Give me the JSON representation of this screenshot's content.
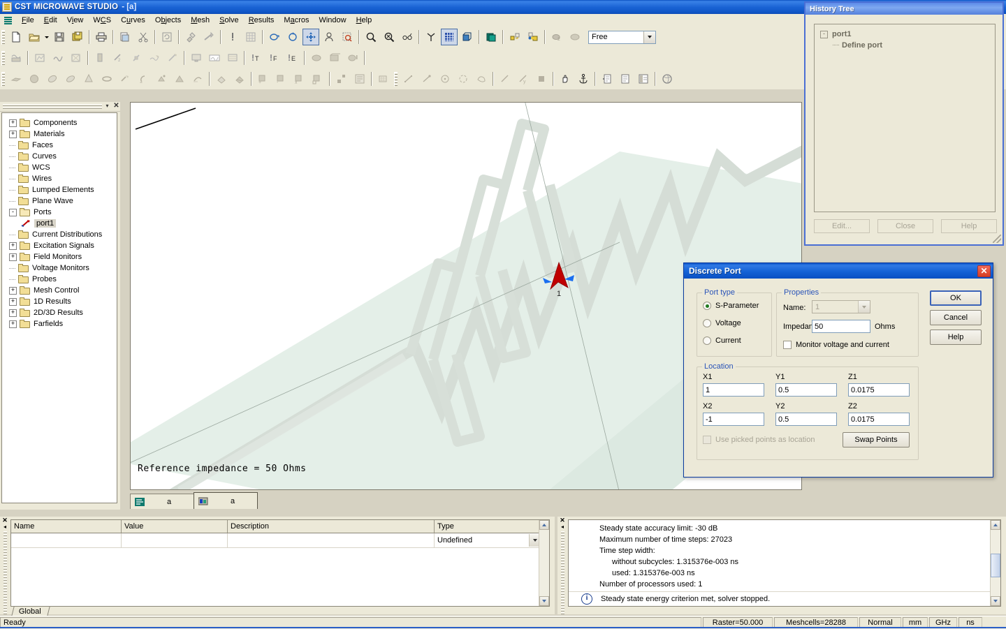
{
  "app": {
    "title": "CST MICROWAVE STUDIO",
    "document": "- [a]",
    "icon": "cst-logo-icon"
  },
  "menubar": {
    "logo_icon": "cst-menu-logo-icon",
    "items": [
      {
        "label": "File",
        "name": "menu-file"
      },
      {
        "label": "Edit",
        "name": "menu-edit"
      },
      {
        "label": "View",
        "name": "menu-view"
      },
      {
        "label": "WCS",
        "name": "menu-wcs"
      },
      {
        "label": "Curves",
        "name": "menu-curves"
      },
      {
        "label": "Objects",
        "name": "menu-objects"
      },
      {
        "label": "Mesh",
        "name": "menu-mesh"
      },
      {
        "label": "Solve",
        "name": "menu-solve"
      },
      {
        "label": "Results",
        "name": "menu-results"
      },
      {
        "label": "Macros",
        "name": "menu-macros"
      },
      {
        "label": "Window",
        "name": "menu-window"
      },
      {
        "label": "Help",
        "name": "menu-help"
      }
    ]
  },
  "toolbar": {
    "mode_combo_value": "Free",
    "row1_icons": [
      "new-file-icon",
      "open-folder-icon",
      "save-disk-icon",
      "save-all-icon",
      "print-icon",
      "print-preview-icon",
      "cut-scissors-icon",
      "refresh-icon",
      "paste-pin-icon",
      "undo-arrow-icon",
      "exclamation-icon",
      "mesh-view-icon",
      "rotate-view-icon",
      "rotate-cw-icon",
      "pan-move-icon",
      "perspective-icon",
      "zoom-region-icon",
      "zoom-in-icon",
      "zoom-out-icon",
      "view-glasses-icon",
      "axes-icon",
      "grid-icon",
      "boundary-box-icon",
      "field-plot-icon",
      "local-wcs-icon",
      "global-wcs-icon",
      "cut-plane-icon",
      "transparency-icon"
    ],
    "row2_icons": [
      "signal-icon",
      "field-monitor-icon",
      "curve-plot-icon",
      "port-box-icon",
      "waveguide-port-icon",
      "discrete-port-icon",
      "lumped-element-icon",
      "plane-wave-icon",
      "farfield-source-icon",
      "monitor-screen-icon",
      "result-template-icon",
      "post-process-icon",
      "time-monitor-icon",
      "frequency-monitor-icon",
      "energy-monitor-icon",
      "material-icon",
      "material-lib-icon",
      "material-info-icon"
    ],
    "row3_icons": [
      "brick-icon",
      "sphere-icon",
      "cylinder-icon",
      "ecylinder-icon",
      "cone-icon",
      "torus-icon",
      "extrude-icon",
      "rotate-solid-icon",
      "loft-icon",
      "sweep-icon",
      "bend-icon",
      "align-icon",
      "pick-face-icon",
      "pick-edge-icon",
      "boolean-add-icon",
      "boolean-subtract-icon",
      "boolean-intersect-icon",
      "boolean-insert-icon",
      "transform-icon",
      "properties-icon",
      "mesh-group-icon",
      "line-pick-icon",
      "point-pick-icon",
      "circle-center-icon",
      "circle-icon",
      "face-pick-icon",
      "distance-icon",
      "angle-icon",
      "area-icon",
      "pan-hand-icon",
      "anchor-icon",
      "list-add-icon",
      "list-icon",
      "list-view-icon",
      "globe-icon"
    ]
  },
  "navtree": {
    "header_buttons": [
      "minimize-icon",
      "close-icon"
    ],
    "items": [
      {
        "label": "Components",
        "expander": "+",
        "indent": 0,
        "icon": "folder-icon"
      },
      {
        "label": "Materials",
        "expander": "+",
        "indent": 0,
        "icon": "folder-icon"
      },
      {
        "label": "Faces",
        "expander": "",
        "indent": 0,
        "icon": "folder-icon"
      },
      {
        "label": "Curves",
        "expander": "",
        "indent": 0,
        "icon": "folder-icon"
      },
      {
        "label": "WCS",
        "expander": "",
        "indent": 0,
        "icon": "folder-icon"
      },
      {
        "label": "Wires",
        "expander": "",
        "indent": 0,
        "icon": "folder-icon"
      },
      {
        "label": "Lumped Elements",
        "expander": "",
        "indent": 0,
        "icon": "folder-icon"
      },
      {
        "label": "Plane Wave",
        "expander": "",
        "indent": 0,
        "icon": "folder-icon"
      },
      {
        "label": "Ports",
        "expander": "-",
        "indent": 0,
        "icon": "folder-open-icon"
      },
      {
        "label": "port1",
        "expander": "",
        "indent": 1,
        "icon": "discrete-port-icon",
        "selected": true
      },
      {
        "label": "Current Distributions",
        "expander": "",
        "indent": 0,
        "icon": "folder-icon"
      },
      {
        "label": "Excitation Signals",
        "expander": "+",
        "indent": 0,
        "icon": "folder-icon"
      },
      {
        "label": "Field Monitors",
        "expander": "+",
        "indent": 0,
        "icon": "folder-icon"
      },
      {
        "label": "Voltage Monitors",
        "expander": "",
        "indent": 0,
        "icon": "folder-icon"
      },
      {
        "label": "Probes",
        "expander": "",
        "indent": 0,
        "icon": "folder-icon"
      },
      {
        "label": "Mesh Control",
        "expander": "+",
        "indent": 0,
        "icon": "folder-icon"
      },
      {
        "label": "1D Results",
        "expander": "+",
        "indent": 0,
        "icon": "folder-icon"
      },
      {
        "label": "2D/3D Results",
        "expander": "+",
        "indent": 0,
        "icon": "folder-icon"
      },
      {
        "label": "Farfields",
        "expander": "+",
        "indent": 0,
        "icon": "folder-icon"
      }
    ]
  },
  "viewport": {
    "reference_impedance_text": "Reference impedance = 50 Ohms",
    "port_label": "1",
    "substrate_color": "#e4efe8",
    "trace_color": "#d5ddd6",
    "port_arrow_color": "#c00000",
    "port_wing_color": "#1a6ef0",
    "tabs": [
      {
        "label": "a",
        "icon": "schematic-view-icon",
        "active": false
      },
      {
        "label": "a",
        "icon": "3d-model-view-icon",
        "active": true
      }
    ]
  },
  "history_tree": {
    "title": "History Tree",
    "items": [
      {
        "label": "port1",
        "expander": "-",
        "indent": 0
      },
      {
        "label": "Define port",
        "expander": "",
        "indent": 1
      }
    ],
    "buttons": [
      {
        "label": "Edit...",
        "name": "history-edit-button"
      },
      {
        "label": "Close",
        "name": "history-close-button"
      },
      {
        "label": "Help",
        "name": "history-help-button"
      }
    ]
  },
  "dialog": {
    "title": "Discrete Port",
    "close_icon": "close-x-icon",
    "port_type": {
      "legend": "Port type",
      "options": [
        {
          "label": "S-Parameter",
          "selected": true
        },
        {
          "label": "Voltage",
          "selected": false
        },
        {
          "label": "Current",
          "selected": false
        }
      ]
    },
    "properties": {
      "legend": "Properties",
      "name_label": "Name:",
      "name_value": "1",
      "impedance_label": "Impedance:",
      "impedance_value": "50",
      "impedance_units": "Ohms",
      "monitor_label": "Monitor voltage and current",
      "monitor_checked": false
    },
    "location": {
      "legend": "Location",
      "fields": [
        {
          "label": "X1",
          "value": "1"
        },
        {
          "label": "Y1",
          "value": "0.5"
        },
        {
          "label": "Z1",
          "value": "0.0175"
        },
        {
          "label": "X2",
          "value": "-1"
        },
        {
          "label": "Y2",
          "value": "0.5"
        },
        {
          "label": "Z2",
          "value": "0.0175"
        }
      ],
      "use_picked_label": "Use picked points as location",
      "use_picked_checked": false,
      "use_picked_enabled": false,
      "swap_button": "Swap Points"
    },
    "buttons": [
      {
        "label": "OK",
        "name": "ok-button",
        "default": true
      },
      {
        "label": "Cancel",
        "name": "cancel-button",
        "default": false
      },
      {
        "label": "Help",
        "name": "help-button",
        "default": false
      }
    ]
  },
  "param_table": {
    "columns": [
      "Name",
      "Value",
      "Description",
      "Type"
    ],
    "rows": [
      {
        "name": "",
        "value": "",
        "description": "",
        "type": "Undefined"
      }
    ],
    "tab_label": "Global"
  },
  "messages": {
    "lines": [
      {
        "text": "Steady state accuracy limit: -30 dB",
        "indent": false,
        "icon": null
      },
      {
        "text": "Maximum number of time steps: 27023",
        "indent": false,
        "icon": null
      },
      {
        "text": "Time step width:",
        "indent": false,
        "icon": null
      },
      {
        "text": "without subcycles: 1.315376e-003 ns",
        "indent": true,
        "icon": null
      },
      {
        "text": "used: 1.315376e-003 ns",
        "indent": true,
        "icon": null
      },
      {
        "text": "Number of processors used: 1",
        "indent": false,
        "icon": null
      },
      {
        "text": "Steady state energy criterion met, solver stopped.",
        "indent": false,
        "icon": "info-icon"
      }
    ]
  },
  "statusbar": {
    "ready": "Ready",
    "cells": [
      "Raster=50.000",
      "Meshcells=28288",
      "Normal",
      "mm",
      "GHz",
      "ns"
    ]
  },
  "colors": {
    "title_blue": "#1462d6",
    "dialog_face": "#ece9d8",
    "group_label_blue": "#2a54b8",
    "accent_red": "#d63c22"
  }
}
